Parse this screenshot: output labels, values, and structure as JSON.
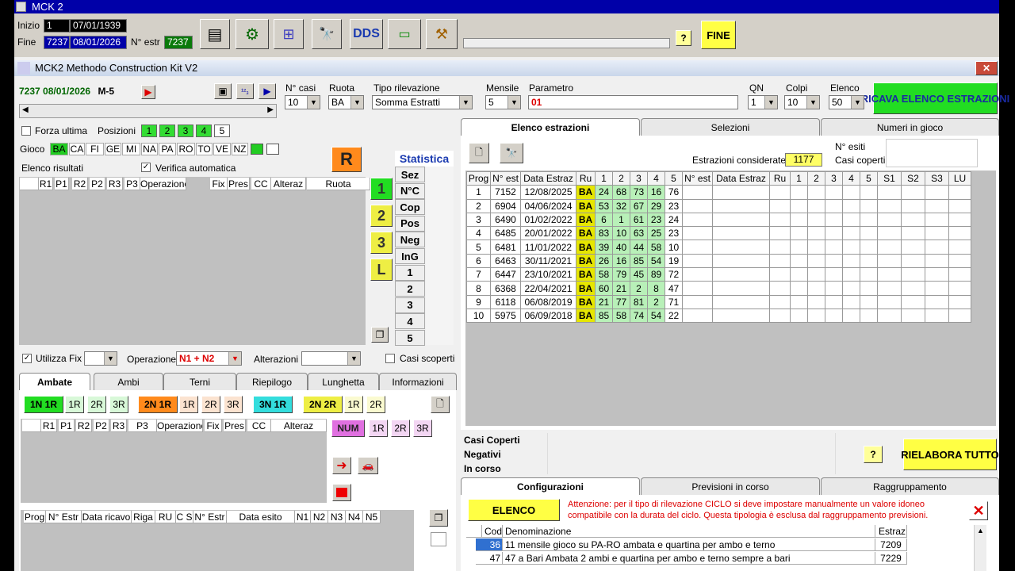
{
  "app": {
    "title": "MCK 2",
    "inner_title": "MCK2 Methodo Construction Kit V2"
  },
  "top": {
    "inizio_label": "Inizio",
    "inizio_n": "1",
    "inizio_date": "07/01/1939",
    "fine_label": "Fine",
    "fine_n": "7237",
    "fine_date": "08/01/2026",
    "nestr_label": "N° estr",
    "nestr_value": "7237",
    "fine_button": "FINE",
    "help": "?"
  },
  "left": {
    "current": "7237 08/01/2026",
    "current_m": "M-5",
    "forza_label": "Forza ultima",
    "posizioni_label": "Posizioni",
    "posizioni": [
      "1",
      "2",
      "3",
      "4",
      "5"
    ],
    "gioco_label": "Gioco",
    "gioco": [
      "BA",
      "CA",
      "FI",
      "GE",
      "MI",
      "NA",
      "PA",
      "RO",
      "TO",
      "VE",
      "NZ"
    ],
    "elenco_label": "Elenco risultati",
    "verifica_label": "Verifica automatica",
    "r_button": "R",
    "results_headers": [
      "R1",
      "P1",
      "R2",
      "P2",
      "R3",
      "P3",
      "Operazione",
      "Fix",
      "Pres",
      "CC",
      "Alteraz",
      "Ruota"
    ],
    "num_buttons": [
      "1",
      "2",
      "3",
      "L"
    ],
    "utilizza_fix": "Utilizza Fix",
    "operazione_label": "Operazione",
    "operazione_value": "N1 + N2",
    "alterazioni_label": "Alterazioni",
    "casi_scoperti": "Casi scoperti"
  },
  "statistica": {
    "title": "Statistica",
    "items": [
      "Sez",
      "N°C",
      "Cop",
      "Pos",
      "Neg",
      "InG",
      "1",
      "2",
      "3",
      "4",
      "5"
    ]
  },
  "params": {
    "ncasi_label": "N° casi",
    "ncasi": "10",
    "ruota_label": "Ruota",
    "ruota": "BA",
    "tipo_label": "Tipo rilevazione",
    "tipo": "Somma Estratti",
    "mensile_label": "Mensile",
    "mensile": "5",
    "parametro_label": "Parametro",
    "parametro": "01",
    "qn_label": "QN",
    "qn": "1",
    "colpi_label": "Colpi",
    "colpi": "10",
    "elenco_label": "Elenco",
    "elenco": "50",
    "ricava": "RICAVA ELENCO ESTRAZIONI"
  },
  "tabs_right": [
    "Elenco estrazioni",
    "Selezioni",
    "Numeri in gioco"
  ],
  "estr": {
    "considerate_label": "Estrazioni considerate",
    "considerate": "1177",
    "nesiti_label": "N° esiti",
    "casi_coperti_label": "Casi coperti",
    "headers": [
      "Prog",
      "N° est",
      "Data Estraz",
      "Ru",
      "1",
      "2",
      "3",
      "4",
      "5",
      "N° est",
      "Data Estraz",
      "Ru",
      "1",
      "2",
      "3",
      "4",
      "5",
      "S1",
      "S2",
      "S3",
      "LU"
    ],
    "rows": [
      [
        "1",
        "7152",
        "12/08/2025",
        "BA",
        "24",
        "68",
        "73",
        "16",
        "76"
      ],
      [
        "2",
        "6904",
        "04/06/2024",
        "BA",
        "53",
        "32",
        "67",
        "29",
        "23"
      ],
      [
        "3",
        "6490",
        "01/02/2022",
        "BA",
        "6",
        "1",
        "61",
        "23",
        "24"
      ],
      [
        "4",
        "6485",
        "20/01/2022",
        "BA",
        "83",
        "10",
        "63",
        "25",
        "23"
      ],
      [
        "5",
        "6481",
        "11/01/2022",
        "BA",
        "39",
        "40",
        "44",
        "58",
        "10"
      ],
      [
        "6",
        "6463",
        "30/11/2021",
        "BA",
        "26",
        "16",
        "85",
        "54",
        "19"
      ],
      [
        "7",
        "6447",
        "23/10/2021",
        "BA",
        "58",
        "79",
        "45",
        "89",
        "72"
      ],
      [
        "8",
        "6368",
        "22/04/2021",
        "BA",
        "60",
        "21",
        "2",
        "8",
        "47"
      ],
      [
        "9",
        "6118",
        "06/08/2019",
        "BA",
        "21",
        "77",
        "81",
        "2",
        "71"
      ],
      [
        "10",
        "5975",
        "06/09/2018",
        "BA",
        "85",
        "58",
        "74",
        "54",
        "22"
      ]
    ]
  },
  "summary": {
    "casi_coperti": "Casi Coperti",
    "negativi": "Negativi",
    "in_corso": "In corso",
    "rielabora": "RIELABORA TUTTO",
    "help": "?"
  },
  "tabs_config": [
    "Configurazioni",
    "Previsioni in corso",
    "Raggruppamento"
  ],
  "config": {
    "elenco_button": "ELENCO",
    "warning": "Attenzione: per il tipo di rilevazione CICLO si deve impostare manualmente un valore idoneo compatibile con la durata del ciclo. Questa tipologia è esclusa dal raggruppamento previsioni.",
    "headers": [
      "Cod",
      "Denominazione",
      "Estraz"
    ],
    "rows": [
      [
        "36",
        "11 mensile gioco su PA-RO ambata e quartina per ambo e terno",
        "7209"
      ],
      [
        "47",
        "47 a Bari Ambata 2 ambi e quartina per ambo e terno sempre a bari",
        "7229"
      ]
    ]
  },
  "tabs_bottom": [
    "Ambate",
    "Ambi",
    "Terni",
    "Riepilogo",
    "Lunghetta",
    "Informazioni"
  ],
  "ambate": {
    "buttons": [
      [
        "1N 1R",
        "1R",
        "2R",
        "3R"
      ],
      [
        "2N 1R",
        "1R",
        "2R",
        "3R"
      ],
      [
        "3N 1R"
      ],
      [
        "2N 2R",
        "1R",
        "2R"
      ]
    ],
    "headers": [
      "R1",
      "P1",
      "R2",
      "P2",
      "R3",
      "P3",
      "Operazione",
      "Fix",
      "Pres",
      "CC",
      "Alteraz"
    ],
    "num": "NUM",
    "num_r": [
      "1R",
      "2R",
      "3R"
    ],
    "bottom_headers": [
      "Prog",
      "N° Estr",
      "Data ricavo",
      "Riga",
      "RU",
      "C S",
      "N° Estr",
      "Data esito",
      "N1",
      "N2",
      "N3",
      "N4",
      "N5"
    ]
  },
  "colors": {
    "title_blue": "#0000a8",
    "green": "#22dd22",
    "yellow": "#eeee44",
    "ba_yellow": "#e6e600"
  }
}
